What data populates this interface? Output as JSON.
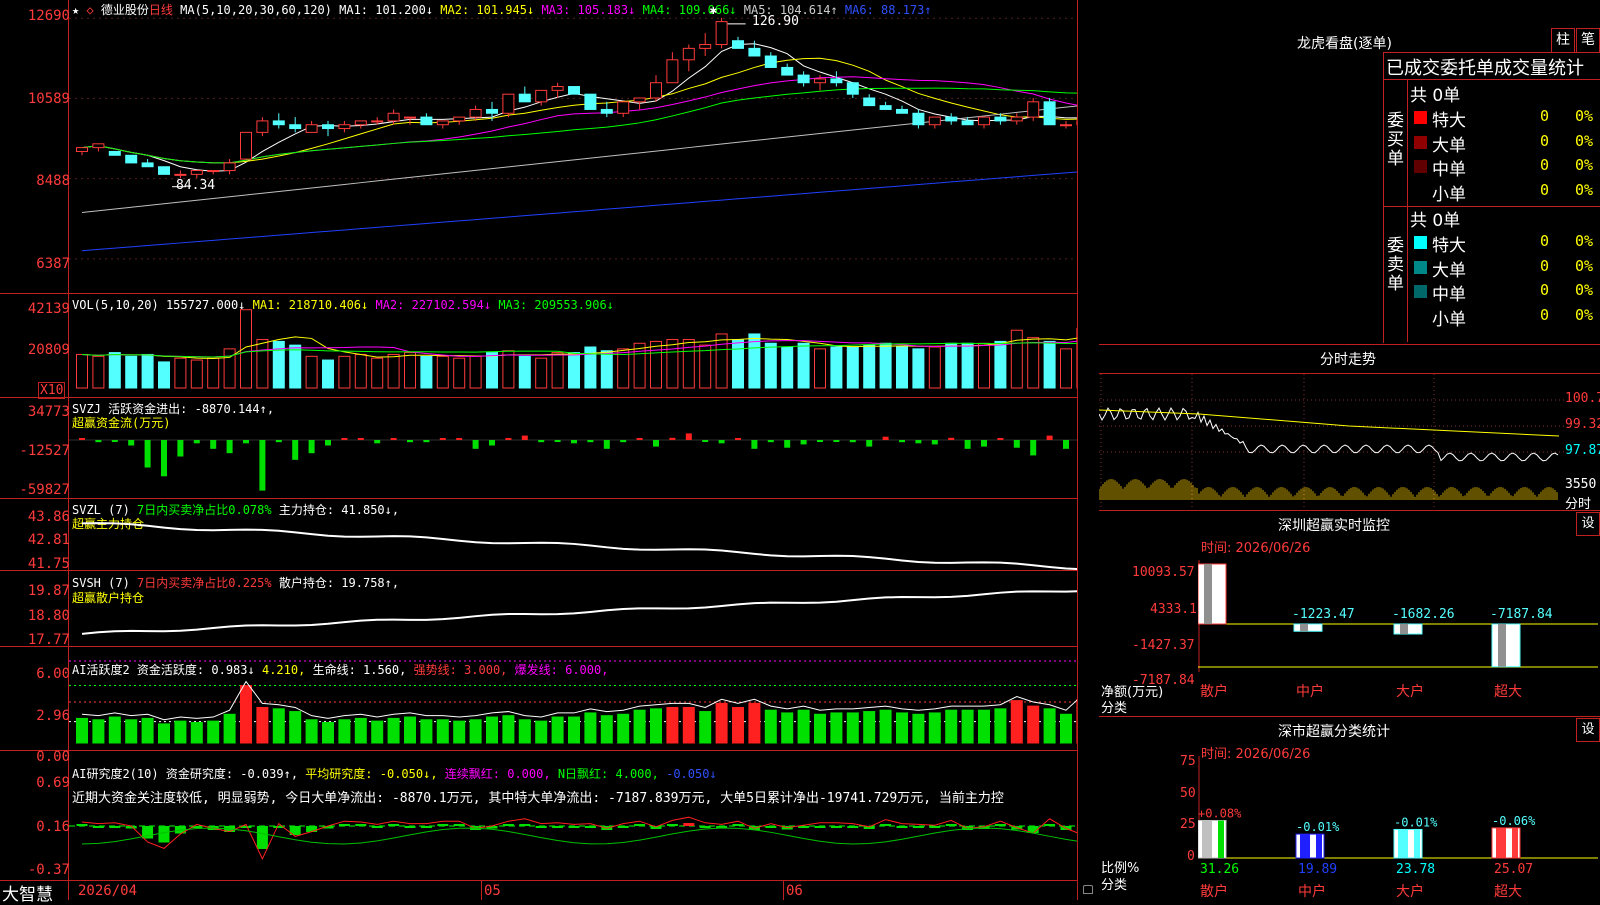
{
  "stock": {
    "name": "德业股份",
    "period": "日线"
  },
  "ma_header": {
    "prefix": "MA(5,10,20,30,60,120)",
    "ma1": "MA1: 101.200↓",
    "ma2": "MA2: 101.945↓",
    "ma3": "MA3: 105.183↓",
    "ma4": "MA4: 109.066↓",
    "ma5": "MA5: 104.614↑",
    "ma6": "MA6: 88.173↑"
  },
  "price_axis": [
    "12690",
    "10589",
    "8488",
    "6387"
  ],
  "price_marks": {
    "high": "126.90",
    "low": "84.34"
  },
  "vol": {
    "header": "VOL(5,10,20)",
    "value": "155727.000↓",
    "ma1": "MA1: 218710.406↓",
    "ma2": "MA2: 227102.594↓",
    "ma3": "MA3: 209553.906↓",
    "axis": [
      "42139",
      "20809"
    ],
    "unit": "X10"
  },
  "svzj": {
    "header": "SVZJ",
    "label": "活跃资金进出: -8870.144↑,",
    "sub": "超赢资金流(万元)",
    "axis": [
      "34773",
      "-12527",
      "-59827"
    ]
  },
  "svzl": {
    "header": "SVZL (7)",
    "ratio": "7日内买卖净占比0.078%",
    "hold": "主力持仓: 41.850↓,",
    "sub": "超赢主力持仓",
    "axis": [
      "43.86",
      "42.81",
      "41.75"
    ]
  },
  "svsh": {
    "header": "SVSH (7)",
    "ratio": "7日内买卖净占比0.225%",
    "hold": "散户持仓: 19.758↑,",
    "sub": "超赢散户持仓",
    "axis": [
      "19.87",
      "18.80",
      "17.77"
    ]
  },
  "ai1": {
    "header": "AI活跃度2",
    "act": "资金活跃度: 0.983↓",
    "v2": "4.210,",
    "life": "生命线: 1.560,",
    "strong": "强势线: 3.000,",
    "burst": "爆发线: 6.000,",
    "axis": [
      "6.00",
      "2.96",
      "0.00"
    ]
  },
  "ai2": {
    "header": "AI研究度2(10)",
    "res": "资金研究度: -0.039↑,",
    "avg": "平均研究度: -0.050↓,",
    "red": "连续飘红: 0.000,",
    "nred": "N日飘红: 4.000,",
    "last": "-0.050↓",
    "text": "近期大资金关注度较低, 明显弱势, 今日大单净流出: -8870.1万元, 其中特大单净流出: -7187.839万元, 大单5日累计净出-19741.729万元, 当前主力控",
    "axis": [
      "0.69",
      "0.16",
      "-0.37"
    ]
  },
  "date_axis": [
    "2026/04",
    "05",
    "06"
  ],
  "brand": "大智慧",
  "right": {
    "lhb_title": "龙虎看盘(逐单)",
    "btn_zhu": "柱",
    "btn_bi": "笔",
    "stats_header": "已成交委托单成交量统计",
    "buy_total": "共 0单",
    "buy_side": "委买单",
    "sell_total": "共 0单",
    "sell_side": "委卖单",
    "buy_rows": [
      {
        "label": "特大",
        "count": "0",
        "pct": "0%",
        "color": "#ff0000"
      },
      {
        "label": "大单",
        "count": "0",
        "pct": "0%",
        "color": "#900000"
      },
      {
        "label": "中单",
        "count": "0",
        "pct": "0%",
        "color": "#600000"
      },
      {
        "label": "小单",
        "count": "0",
        "pct": "0%",
        "color": "#000000"
      }
    ],
    "sell_rows": [
      {
        "label": "特大",
        "count": "0",
        "pct": "0%",
        "color": "#00ffff"
      },
      {
        "label": "大单",
        "count": "0",
        "pct": "0%",
        "color": "#008888"
      },
      {
        "label": "中单",
        "count": "0",
        "pct": "0%",
        "color": "#006868"
      },
      {
        "label": "小单",
        "count": "0",
        "pct": "0%",
        "color": "#000000"
      }
    ],
    "fs_title": "分时走势",
    "fs_axis": [
      "100.7",
      "99.32",
      "97.87",
      "3550"
    ],
    "fs_unit": "分时",
    "monitor_title": "深圳超赢实时监控",
    "monitor_btn": "设",
    "monitor_date": "时间: 2026/06/26",
    "monitor_axis": [
      "10093.57",
      "4333.1",
      "-1427.37",
      "-7187.84"
    ],
    "monitor_ylabel": "净额(万元)",
    "monitor_xlabel": "分类",
    "monitor_bars": [
      {
        "cat": "散户",
        "val": "10093.57"
      },
      {
        "cat": "中户",
        "val": "-1223.47"
      },
      {
        "cat": "大户",
        "val": "-1682.26"
      },
      {
        "cat": "超大",
        "val": "-7187.84"
      }
    ],
    "class_title": "深市超赢分类统计",
    "class_btn": "设",
    "class_date": "时间: 2026/06/26",
    "class_axis": [
      "75",
      "50",
      "25",
      "0"
    ],
    "class_ylabel": "比例%",
    "class_xlabel": "分类",
    "class_bars": [
      {
        "cat": "散户",
        "pct": "31.26",
        "chg": "+0.08%"
      },
      {
        "cat": "中户",
        "pct": "19.89",
        "chg": "-0.01%"
      },
      {
        "cat": "大户",
        "pct": "23.78",
        "chg": "-0.01%"
      },
      {
        "cat": "超大",
        "pct": "25.07",
        "chg": "-0.06%"
      }
    ]
  },
  "chart_data": {
    "type": "candlestick",
    "candles": [
      [
        92,
        93,
        91,
        93
      ],
      [
        93,
        94,
        92,
        94
      ],
      [
        92,
        92,
        91,
        91
      ],
      [
        91,
        91,
        89,
        89
      ],
      [
        89,
        90,
        88,
        88
      ],
      [
        88,
        88,
        86,
        86
      ],
      [
        86,
        87,
        85,
        86
      ],
      [
        86,
        87,
        85,
        87
      ],
      [
        87,
        87,
        86,
        87
      ],
      [
        87,
        90,
        86,
        89
      ],
      [
        90,
        97,
        90,
        97
      ],
      [
        97,
        101,
        96,
        100
      ],
      [
        100,
        102,
        98,
        99
      ],
      [
        99,
        101,
        97,
        98
      ],
      [
        97,
        100,
        97,
        99
      ],
      [
        99,
        100,
        96,
        98
      ],
      [
        98,
        100,
        97,
        99
      ],
      [
        99,
        100,
        98,
        100
      ],
      [
        100,
        101,
        99,
        100
      ],
      [
        100,
        103,
        99,
        102
      ],
      [
        101,
        101,
        99,
        101
      ],
      [
        101,
        102,
        99,
        99
      ],
      [
        99,
        100,
        98,
        100
      ],
      [
        100,
        100,
        99,
        101
      ],
      [
        101,
        104,
        100,
        103
      ],
      [
        103,
        105,
        100,
        102
      ],
      [
        102,
        107,
        101,
        107
      ],
      [
        107,
        109,
        105,
        105
      ],
      [
        105,
        107,
        104,
        108
      ],
      [
        108,
        110,
        106,
        109
      ],
      [
        109,
        109,
        107,
        107
      ],
      [
        107,
        107,
        103,
        103
      ],
      [
        103,
        105,
        101,
        102
      ],
      [
        102,
        105,
        101,
        105
      ],
      [
        105,
        106,
        103,
        106
      ],
      [
        106,
        112,
        105,
        110
      ],
      [
        110,
        118,
        110,
        116
      ],
      [
        116,
        120,
        113,
        119
      ],
      [
        119,
        123,
        117,
        120
      ],
      [
        120,
        127,
        119,
        126
      ],
      [
        121,
        122,
        119,
        119
      ],
      [
        119,
        121,
        117,
        117
      ],
      [
        117,
        118,
        114,
        114
      ],
      [
        114,
        115,
        112,
        112
      ],
      [
        112,
        113,
        109,
        110
      ],
      [
        110,
        112,
        108,
        111
      ],
      [
        111,
        113,
        109,
        110
      ],
      [
        110,
        110,
        106,
        107
      ],
      [
        106,
        107,
        104,
        104
      ],
      [
        104,
        105,
        103,
        103
      ],
      [
        103,
        104,
        102,
        102
      ],
      [
        102,
        103,
        98,
        99
      ],
      [
        99,
        101,
        98,
        101
      ],
      [
        101,
        102,
        99,
        100
      ],
      [
        100,
        101,
        99,
        99
      ],
      [
        99,
        101,
        98,
        101
      ],
      [
        101,
        102,
        99,
        100
      ],
      [
        100,
        102,
        99,
        101
      ],
      [
        101,
        106,
        100,
        105
      ],
      [
        105,
        106,
        99,
        99
      ],
      [
        99,
        100,
        98,
        99
      ],
      [
        99,
        101,
        98,
        100
      ],
      [
        100,
        100,
        97,
        98
      ],
      [
        98,
        98,
        95,
        96
      ]
    ],
    "volumes": [
      18,
      17,
      19,
      17,
      18,
      14,
      16,
      15,
      16,
      21,
      42,
      26,
      25,
      23,
      17,
      15,
      17,
      18,
      16,
      18,
      19,
      17,
      17,
      16,
      17,
      19,
      20,
      17,
      16,
      19,
      19,
      22,
      20,
      21,
      24,
      25,
      26,
      26,
      23,
      29,
      26,
      29,
      24,
      22,
      24,
      21,
      22,
      22,
      23,
      24,
      22,
      21,
      22,
      24,
      24,
      24,
      25,
      31,
      27,
      25,
      21,
      32,
      27,
      25,
      22
    ],
    "fund_flow": [
      0,
      -2,
      -1,
      -5,
      -25,
      -33,
      -15,
      -3,
      -8,
      -12,
      -3,
      -46,
      -2,
      -18,
      -12,
      -5,
      1,
      0,
      -3,
      1,
      -2,
      -2,
      1,
      1,
      -8,
      -5,
      1,
      4,
      -2,
      -1,
      -3,
      -2,
      -8,
      -2,
      1,
      -6,
      2,
      6,
      -1,
      -3,
      1,
      -8,
      -2,
      -7,
      -4,
      -1,
      -1,
      -2,
      -6,
      3,
      -2,
      -3,
      -4,
      2,
      -8,
      -6,
      1,
      -7,
      -14,
      4,
      -8,
      -16,
      -5,
      1
    ]
  }
}
